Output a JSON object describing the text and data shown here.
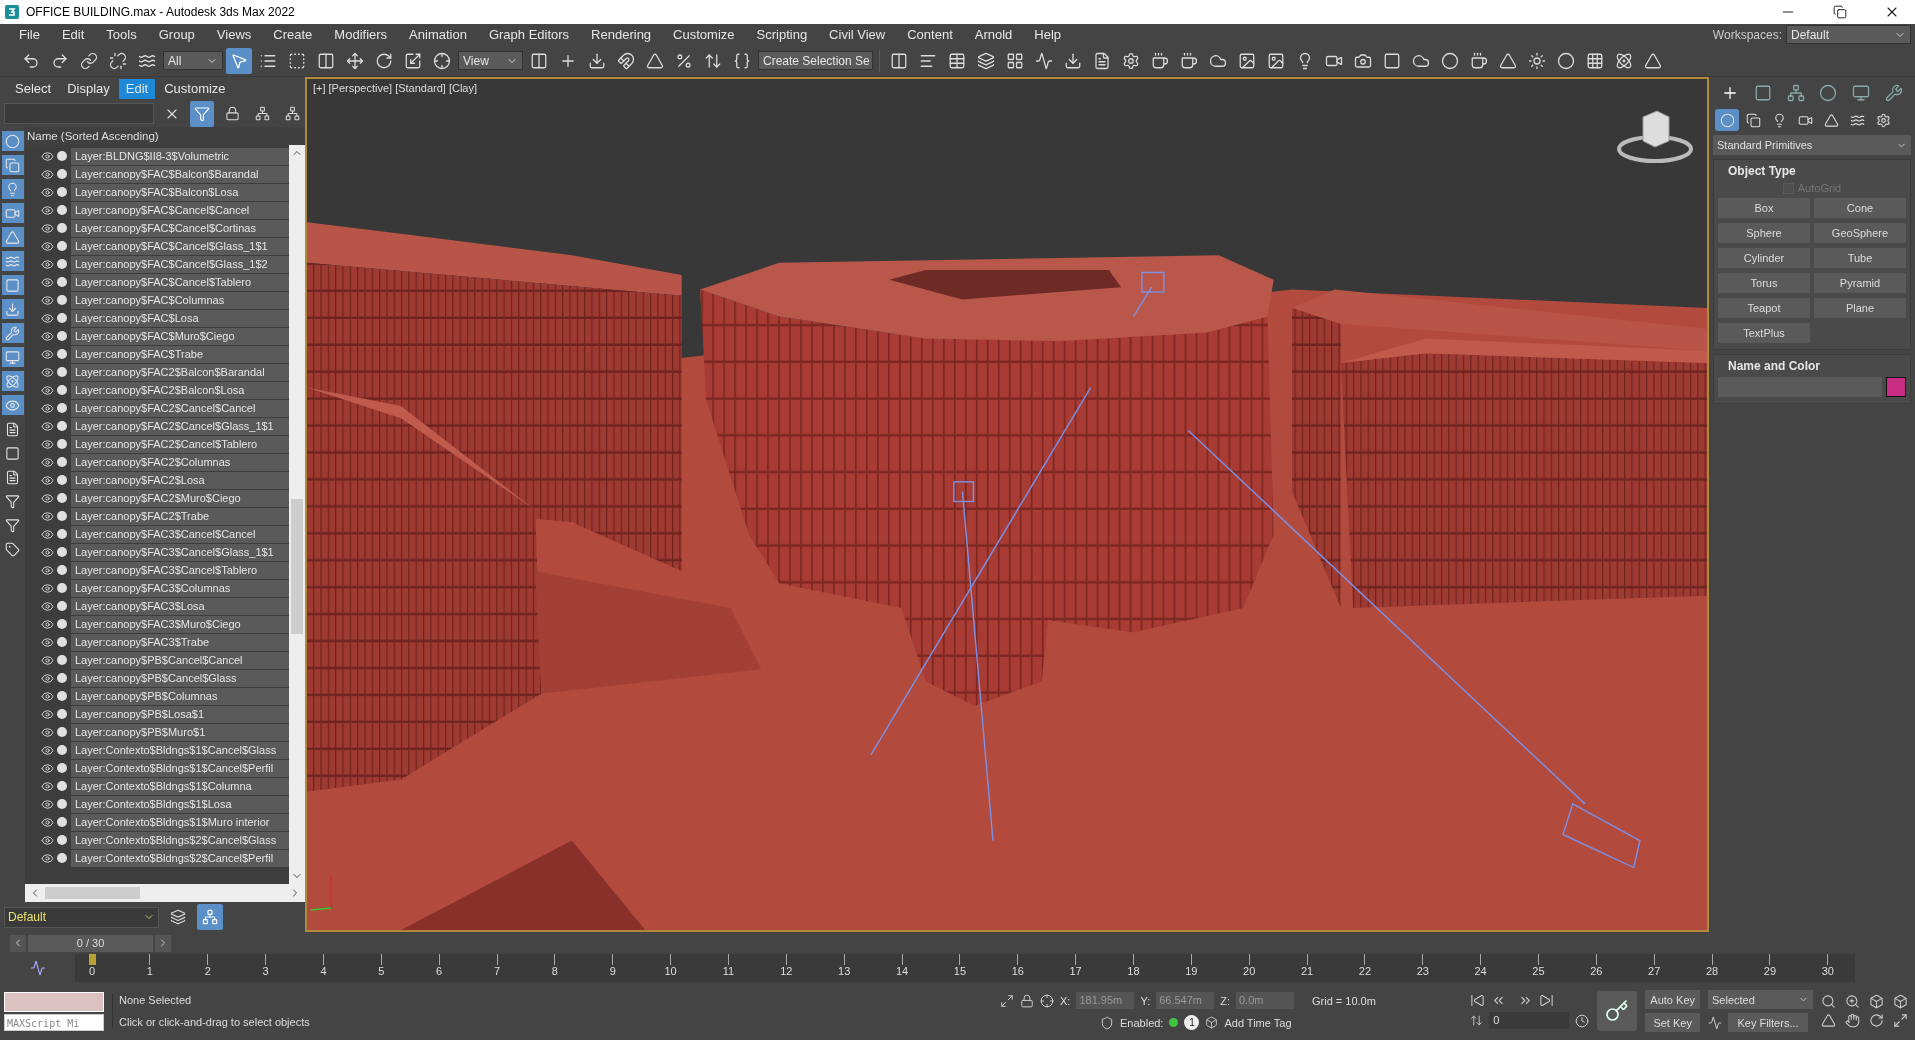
{
  "window": {
    "title": "OFFICE BUILDING.max - Autodesk 3ds Max 2022"
  },
  "menu": [
    "File",
    "Edit",
    "Tools",
    "Group",
    "Views",
    "Create",
    "Modifiers",
    "Animation",
    "Graph Editors",
    "Rendering",
    "Customize",
    "Scripting",
    "Civil View",
    "Content",
    "Arnold",
    "Help"
  ],
  "workspaces": {
    "label": "Workspaces:",
    "value": "Default"
  },
  "toolbar": {
    "selection_filter": "All",
    "reference_coordinate": "View",
    "named_selection": "Create Selection Se",
    "select_object_active": true
  },
  "scene_explorer": {
    "tabs": [
      {
        "label": "Select",
        "selected": false
      },
      {
        "label": "Display",
        "selected": false
      },
      {
        "label": "Edit",
        "selected": true
      },
      {
        "label": "Customize",
        "selected": false
      }
    ],
    "filter_active": true,
    "column_header": "Name (Sorted Ascending)",
    "rows": [
      {
        "name": "Layer:BLDNG$II8-3$Volumetric"
      },
      {
        "name": "Layer:canopy$FAC$Balcon$Barandal"
      },
      {
        "name": "Layer:canopy$FAC$Balcon$Losa"
      },
      {
        "name": "Layer:canopy$FAC$Cancel$Cancel"
      },
      {
        "name": "Layer:canopy$FAC$Cancel$Cortinas"
      },
      {
        "name": "Layer:canopy$FAC$Cancel$Glass_1$1"
      },
      {
        "name": "Layer:canopy$FAC$Cancel$Glass_1$2"
      },
      {
        "name": "Layer:canopy$FAC$Cancel$Tablero"
      },
      {
        "name": "Layer:canopy$FAC$Columnas"
      },
      {
        "name": "Layer:canopy$FAC$Losa"
      },
      {
        "name": "Layer:canopy$FAC$Muro$Ciego"
      },
      {
        "name": "Layer:canopy$FAC$Trabe"
      },
      {
        "name": "Layer:canopy$FAC2$Balcon$Barandal"
      },
      {
        "name": "Layer:canopy$FAC2$Balcon$Losa"
      },
      {
        "name": "Layer:canopy$FAC2$Cancel$Cancel"
      },
      {
        "name": "Layer:canopy$FAC2$Cancel$Glass_1$1"
      },
      {
        "name": "Layer:canopy$FAC2$Cancel$Tablero"
      },
      {
        "name": "Layer:canopy$FAC2$Columnas"
      },
      {
        "name": "Layer:canopy$FAC2$Losa"
      },
      {
        "name": "Layer:canopy$FAC2$Muro$Ciego"
      },
      {
        "name": "Layer:canopy$FAC2$Trabe"
      },
      {
        "name": "Layer:canopy$FAC3$Cancel$Cancel"
      },
      {
        "name": "Layer:canopy$FAC3$Cancel$Glass_1$1"
      },
      {
        "name": "Layer:canopy$FAC3$Cancel$Tablero"
      },
      {
        "name": "Layer:canopy$FAC3$Columnas"
      },
      {
        "name": "Layer:canopy$FAC3$Losa"
      },
      {
        "name": "Layer:canopy$FAC3$Muro$Ciego"
      },
      {
        "name": "Layer:canopy$FAC3$Trabe"
      },
      {
        "name": "Layer:canopy$PB$Cancel$Cancel"
      },
      {
        "name": "Layer:canopy$PB$Cancel$Glass"
      },
      {
        "name": "Layer:canopy$PB$Columnas"
      },
      {
        "name": "Layer:canopy$PB$Losa$1"
      },
      {
        "name": "Layer:canopy$PB$Muro$1"
      },
      {
        "name": "Layer:Contexto$Bldngs$1$Cancel$Glass"
      },
      {
        "name": "Layer:Contexto$Bldngs$1$Cancel$Perfil"
      },
      {
        "name": "Layer:Contexto$Bldngs$1$Columna"
      },
      {
        "name": "Layer:Contexto$Bldngs$1$Losa"
      },
      {
        "name": "Layer:Contexto$Bldngs$1$Muro interior"
      },
      {
        "name": "Layer:Contexto$Bldngs$2$Cancel$Glass"
      },
      {
        "name": "Layer:Contexto$Bldngs$2$Cancel$Perfil"
      }
    ],
    "layer": "Default"
  },
  "viewport": {
    "labels": [
      "[+]",
      "[Perspective]",
      "[Standard]",
      "[Clay]"
    ]
  },
  "command_panel": {
    "tabs": [
      {
        "selected": true
      },
      {
        "selected": false
      },
      {
        "selected": false
      },
      {
        "selected": false
      },
      {
        "selected": false
      },
      {
        "selected": false
      }
    ],
    "categories": [
      {
        "selected": true
      },
      {
        "selected": false
      },
      {
        "selected": false
      },
      {
        "selected": false
      },
      {
        "selected": false
      },
      {
        "selected": false
      },
      {
        "selected": false
      }
    ],
    "category": "Standard Primitives",
    "object_type": {
      "title": "Object Type",
      "autogrid": {
        "label": "AutoGrid",
        "checked": false,
        "disabled": true
      },
      "buttons": [
        "Box",
        "Cone",
        "Sphere",
        "GeoSphere",
        "Cylinder",
        "Tube",
        "Torus",
        "Pyramid",
        "Teapot",
        "Plane",
        "TextPlus"
      ]
    },
    "name_and_color": {
      "title": "Name and Color"
    }
  },
  "time_slider": {
    "label": "0 / 30"
  },
  "timeline": {
    "ticks": [
      "0",
      "1",
      "2",
      "3",
      "4",
      "5",
      "6",
      "7",
      "8",
      "9",
      "10",
      "11",
      "12",
      "13",
      "14",
      "15",
      "16",
      "17",
      "18",
      "19",
      "20",
      "21",
      "22",
      "23",
      "24",
      "25",
      "26",
      "27",
      "28",
      "29",
      "30"
    ]
  },
  "status": {
    "maxscript": "MAXScript Mi",
    "selection": "None Selected",
    "prompt": "Click or click-and-drag to select objects",
    "x_label": "X:",
    "x": "181.95m",
    "y_label": "Y:",
    "y": "66.547m",
    "z_label": "Z:",
    "z": "0.0m",
    "grid": "Grid = 10.0m",
    "enabled_label": "Enabled:",
    "enabled": true,
    "badge": "1",
    "add_time_tag": "Add Time Tag"
  },
  "animation": {
    "frame": "0",
    "auto_key": "Auto Key",
    "key_mode": "Selected",
    "set_key": "Set Key",
    "key_filters": "Key Filters..."
  }
}
